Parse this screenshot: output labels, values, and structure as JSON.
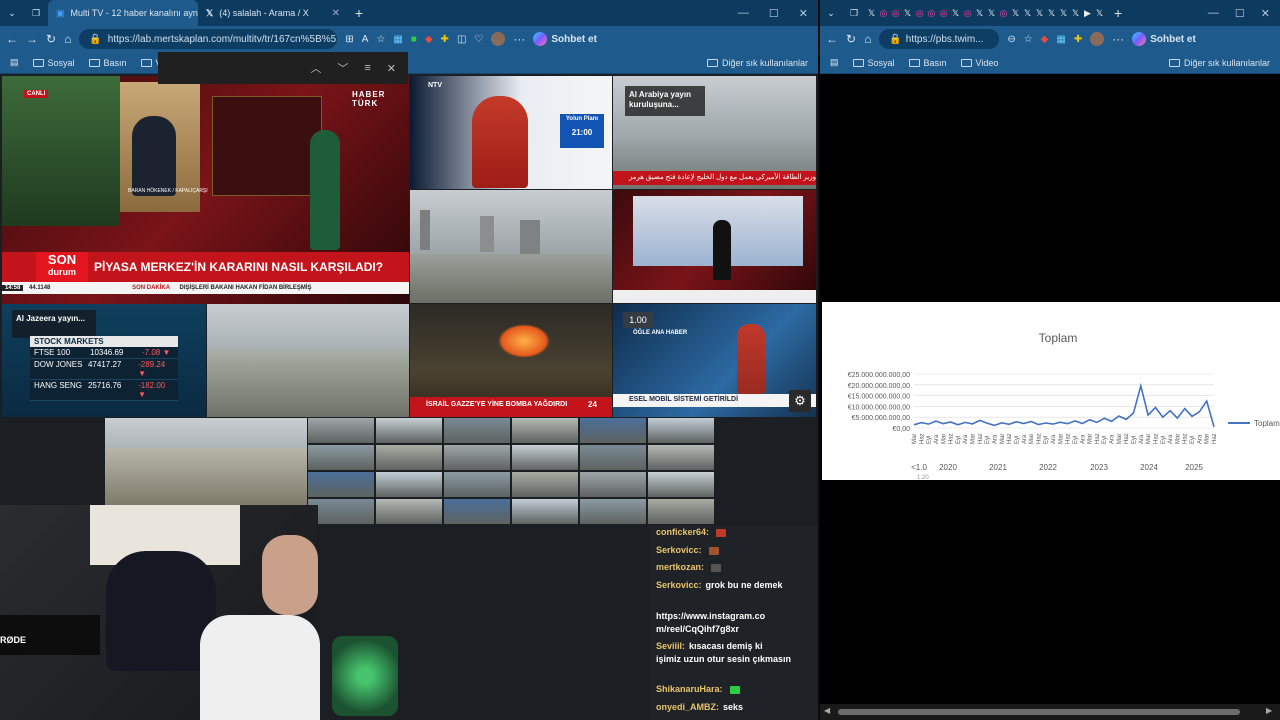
{
  "left_window": {
    "tabs": [
      {
        "title": "Multi TV - 12 haber kanalını aynı a"
      },
      {
        "title": "(4) salalah - Arama / X"
      }
    ],
    "url": "https://lab.mertskaplan.com/multitv/tr/167cn%5B%5D...",
    "copilot_label": "Sohbet et",
    "bookmarks": [
      "Sosyal",
      "Basın",
      "V"
    ],
    "other_bookmarks": "Diğer sık kullanılanlar"
  },
  "right_window": {
    "url": "https://pbs.twim...",
    "copilot_label": "Sohbet et",
    "bookmarks": [
      "Sosyal",
      "Basın",
      "Video"
    ],
    "other_bookmarks": "Diğer sık kullanılanlar"
  },
  "tiles": {
    "haberturk": {
      "live_badge": "CANLI",
      "channel": "HABER TÜRK",
      "reporter": "BARAN HÖKENEK / KAPALIÇARŞI",
      "son_durum": "SON",
      "son_durum2": "durum",
      "headline": "PİYASA MERKEZ'İN KARARINI NASIL KARŞILADI?",
      "time": "14:58",
      "value": "44.1148",
      "breaking_label": "SON DAKİKA",
      "breaking_text": "DIŞİŞLERİ BAKANI HAKAN FİDAN BİRLEŞMİŞ"
    },
    "ntv": {
      "channel": "NTV",
      "program": "Yolun Planı",
      "sub": "21:00"
    },
    "alarabiya": {
      "overlay": "Al Arabiya yayın kuruluşuna...",
      "ticker": "وزير الطاقة الأميركي يعمل مع دول الخليج لإعادة فتح مضيق هرمز"
    },
    "aljazeera": {
      "overlay": "Al Jazeera yayın...",
      "markets_title": "STOCK MARKETS",
      "rows": [
        {
          "name": "FTSE 100",
          "value": "10346.69",
          "change": "-7.08"
        },
        {
          "name": "DOW JONES",
          "value": "47417.27",
          "change": "-289.24"
        },
        {
          "name": "HANG SENG",
          "value": "25716.76",
          "change": "-182.00"
        }
      ]
    },
    "gaza": {
      "headline": "İSRAİL GAZZE'YE YİNE BOMBA YAĞDIRDI",
      "channel": "24"
    },
    "ogle": {
      "speed": "1.00",
      "program": "ÖĞLE ANA HABER",
      "headline": "ESEL MOBİL SİSTEMİ GETİRİLDİ"
    }
  },
  "chat": [
    {
      "user": "conficker64:",
      "msg": "",
      "swatch": "#c0392b"
    },
    {
      "user": "Serkovicc:",
      "msg": "",
      "swatch": "#a0522d"
    },
    {
      "user": "mertkozan:",
      "msg": "",
      "swatch": "#555555"
    },
    {
      "user": "Serkovicc:",
      "msg": "grok bu ne demek",
      "swatch": ""
    },
    {
      "user": "",
      "msg": "https://www.instagram.co",
      "swatch": ""
    },
    {
      "user": "",
      "msg": "m/reel/CqQihf7g8xr",
      "swatch": ""
    },
    {
      "user": "Seviiil:",
      "msg": "kısacası demiş ki",
      "swatch": ""
    },
    {
      "user": "",
      "msg": "işimiz uzun otur sesin çıkmasın",
      "swatch": ""
    },
    {
      "user": "ShikanaruHara:",
      "msg": "",
      "swatch": "#2ecc40"
    },
    {
      "user": "onyedi_AMBZ:",
      "msg": "seks",
      "swatch": ""
    }
  ],
  "webcam": {
    "brand": "RØDE"
  },
  "chart_data": {
    "type": "line",
    "title": "Toplam",
    "series": [
      {
        "name": "Toplam",
        "values": [
          1.5,
          2.5,
          1.8,
          3.2,
          2.0,
          2.8,
          1.5,
          2.6,
          1.9,
          3.5,
          2.2,
          1.2,
          2.4,
          1.7,
          2.9,
          2.1,
          3.0,
          1.6,
          2.3,
          1.8,
          2.7,
          2.0,
          3.3,
          2.1,
          3.8,
          2.6,
          4.5,
          3.1,
          5.5,
          4.0,
          7.0,
          19.5,
          6.0,
          9.5,
          5.0,
          8.0,
          4.6,
          9.0,
          5.4,
          7.5,
          12.5,
          0.5
        ]
      }
    ],
    "ylim": [
      0,
      25
    ],
    "yticks": [
      "€0,00",
      "€5.000.000.000,00",
      "€10.000.000.000,00",
      "€15.000.000.000,00",
      "€20.000.000.000,00",
      "€25.000.000.000,00"
    ],
    "xticks": [
      "<1.0",
      "2020",
      "2021",
      "2022",
      "2023",
      "2024",
      "2025"
    ],
    "xsub": "1.20",
    "legend": "Toplam",
    "legend_position": "right",
    "grid": true,
    "month_labels": [
      "Mar",
      "Haz",
      "Eyl",
      "Ara"
    ]
  }
}
